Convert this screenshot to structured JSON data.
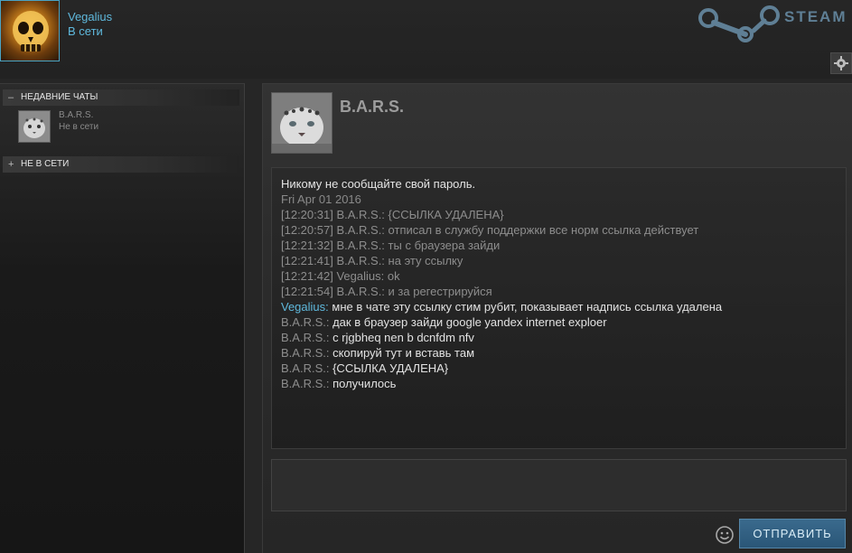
{
  "user": {
    "name": "Vegalius",
    "status": "В сети"
  },
  "brand": {
    "logo_text": "STEAM"
  },
  "sidebar": {
    "groups": [
      {
        "label": "НЕДАВНИЕ ЧАТЫ",
        "sign": "–"
      },
      {
        "label": "НЕ В СЕТИ",
        "sign": "+"
      }
    ],
    "friend": {
      "name": "B.A.R.S.",
      "status": "Не в сети"
    }
  },
  "chat": {
    "title": "B.A.R.S.",
    "warning": "Никому не сообщайте свой пароль.",
    "date": "Fri Apr 01 2016",
    "history": [
      {
        "time": "[12:20:31]",
        "sender": "B.A.R.S.:",
        "text": "{ССЫЛКА УДАЛЕНА}"
      },
      {
        "time": "[12:20:57]",
        "sender": "B.A.R.S.:",
        "text": "отписал в службу поддержки все норм ссылка действует"
      },
      {
        "time": "[12:21:32]",
        "sender": "B.A.R.S.:",
        "text": "ты с браузера зайди"
      },
      {
        "time": "[12:21:41]",
        "sender": "B.A.R.S.:",
        "text": "на эту ссылку"
      },
      {
        "time": "[12:21:42]",
        "sender": "Vegalius:",
        "text": "ok"
      },
      {
        "time": "[12:21:54]",
        "sender": "B.A.R.S.:",
        "text": "и за регестрируйся"
      }
    ],
    "messages": [
      {
        "sender": "Vegalius:",
        "text": "мне в чате эту ссылку стим рубит, показывает надпись ссылка удалена",
        "self": true
      },
      {
        "sender": "B.A.R.S.:",
        "text": "дак в браузер зайди google yandex  internet exploer",
        "self": false
      },
      {
        "sender": "B.A.R.S.:",
        "text": "c rjgbheq nen b dcnfdm nfv",
        "self": false
      },
      {
        "sender": "B.A.R.S.:",
        "text": "скопируй тут и вставь там",
        "self": false
      },
      {
        "sender": "B.A.R.S.:",
        "text": "{ССЫЛКА УДАЛЕНА}",
        "self": false
      },
      {
        "sender": "B.A.R.S.:",
        "text": "получилось",
        "self": false
      }
    ],
    "send_label": "ОТПРАВИТЬ",
    "input_value": ""
  },
  "colors": {
    "accent": "#5fb9dd",
    "send_button": "#2f5f82"
  },
  "icons": [
    "skull-avatar",
    "steam-logo-icon",
    "gear-icon",
    "snow-leopard-avatar",
    "emoticon-icon"
  ]
}
